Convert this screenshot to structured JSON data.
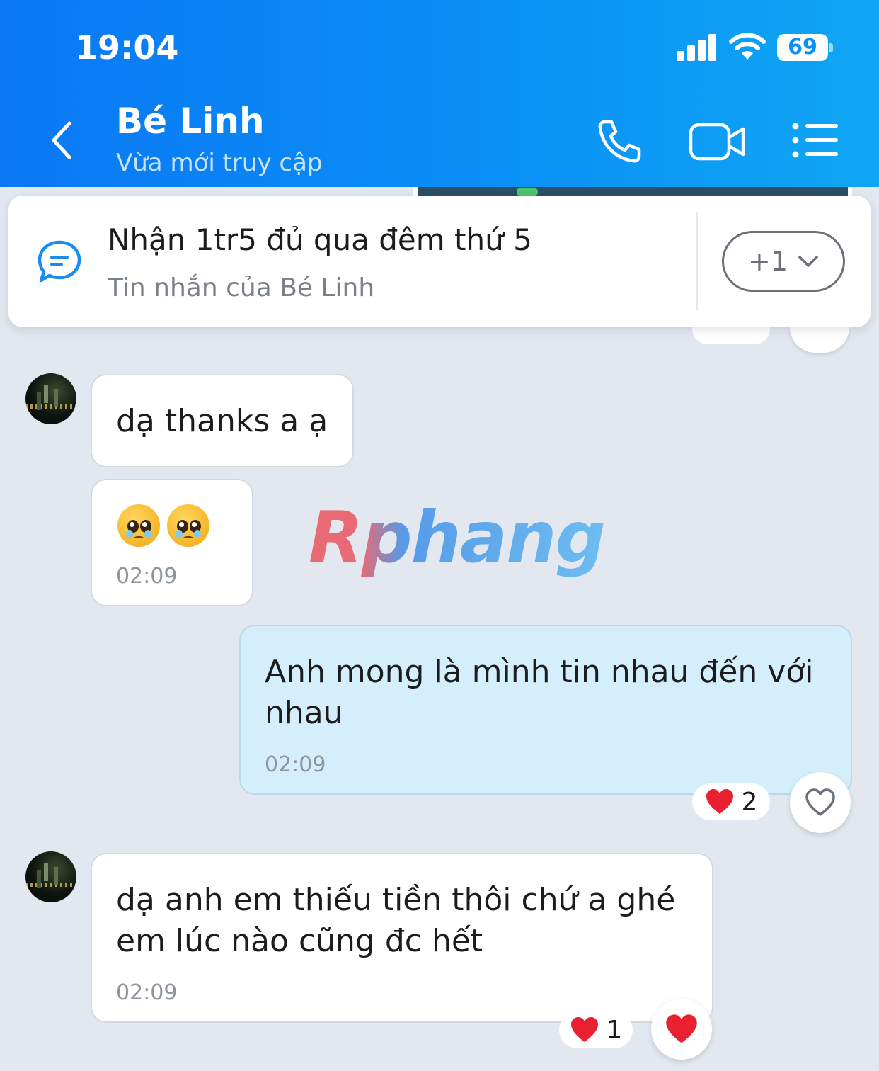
{
  "status_bar": {
    "time": "19:04",
    "battery": "69"
  },
  "header": {
    "contact_name": "Bé Linh",
    "contact_status": "Vừa mới truy cập"
  },
  "pinned": {
    "title": "Nhận 1tr5 đủ qua đêm thứ 5",
    "subtitle": "Tin nhắn của Bé Linh",
    "more_label": "+1"
  },
  "watermark": "Rphang",
  "messages": [
    {
      "text": "dạ thanks a ạ"
    },
    {
      "time": "02:09"
    },
    {
      "text": "Anh mong là mình tin nhau đến với nhau",
      "time": "02:09",
      "reaction_count": "2"
    },
    {
      "text": "dạ anh em thiếu tiền thôi chứ a ghé em lúc nào cũng đc hết",
      "time": "02:09",
      "reaction_count": "1"
    }
  ],
  "colors": {
    "header_start": "#0a78f4",
    "header_end": "#10a6f4",
    "outgoing_bubble": "#d4eefc",
    "heart": "#e8202f"
  },
  "icons": [
    "signal-icon",
    "wifi-icon",
    "back-icon",
    "call-icon",
    "video-call-icon",
    "menu-list-icon",
    "pinned-message-icon",
    "chevron-down-icon",
    "heart-icon",
    "heart-outline-icon"
  ]
}
